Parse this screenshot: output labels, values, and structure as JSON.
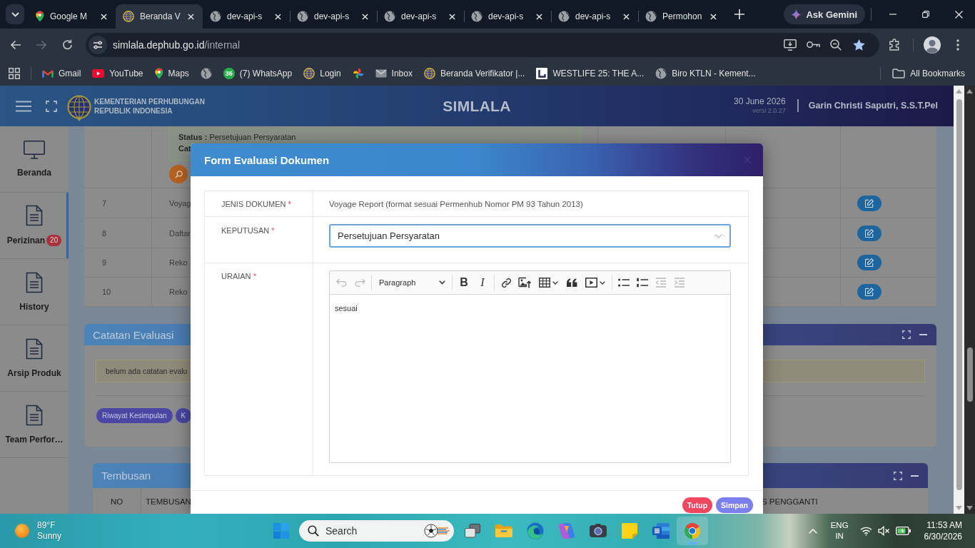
{
  "browser": {
    "tabs": [
      {
        "title": "Google M",
        "selected": false
      },
      {
        "title": "Beranda V",
        "selected": true
      },
      {
        "title": "dev-api-s",
        "selected": false
      },
      {
        "title": "dev-api-s",
        "selected": false
      },
      {
        "title": "dev-api-s",
        "selected": false
      },
      {
        "title": "dev-api-s",
        "selected": false
      },
      {
        "title": "dev-api-s",
        "selected": false
      },
      {
        "title": "Permohon",
        "selected": false
      }
    ],
    "gemini_button": "Ask Gemini",
    "forward_disabled": true,
    "address": {
      "host": "simlala.dephub.go.id",
      "path": "/internal"
    },
    "bookmarks": [
      {
        "kind": "link",
        "label": "Gmail"
      },
      {
        "kind": "link",
        "label": "YouTube"
      },
      {
        "kind": "link",
        "label": "Maps"
      },
      {
        "kind": "icon"
      },
      {
        "kind": "link",
        "label": "(7) WhatsApp",
        "badge": "36"
      },
      {
        "kind": "link",
        "label": "Login"
      },
      {
        "kind": "icon"
      },
      {
        "kind": "link",
        "label": "Inbox"
      },
      {
        "kind": "link",
        "label": "Beranda Verifikator |..."
      },
      {
        "kind": "link",
        "label": "WESTLIFE 25: THE A..."
      },
      {
        "kind": "link",
        "label": "Biro KTLN - Kement..."
      }
    ],
    "all_bookmarks": "All Bookmarks"
  },
  "header": {
    "org_line_1": "KEMENTERIAN PERHUBUNGAN",
    "org_line_2": "REPUBLIK INDONESIA",
    "title": "SIMLALA",
    "date": "30 June 2026",
    "version": "versi 2.0.27",
    "user": "Garin Christi Saputri, S.S.T.Pel"
  },
  "sidebar": {
    "items": [
      {
        "label": "Beranda",
        "selected": false
      },
      {
        "label": "Perizinan",
        "selected": true,
        "badge": "20"
      },
      {
        "label": "History",
        "selected": false
      },
      {
        "label": "Arsip Produk",
        "selected": false
      },
      {
        "label": "Team Perfor…",
        "selected": false
      }
    ]
  },
  "documents_table": {
    "note": {
      "status_line": "**Status :** Persetujuan Persyaratan",
      "cut_line": "Cat"
    },
    "rows": [
      {
        "no": "7",
        "document": "Voyag"
      },
      {
        "no": "8",
        "document": "Daftar"
      },
      {
        "no": "9",
        "document": "Reko"
      },
      {
        "no": "10",
        "document": "Reko"
      }
    ]
  },
  "evaluation_notes": {
    "title": "Catatan Evaluasi",
    "alert": "belum ada catatan evalu",
    "buttons": [
      "Riwayat Kesimpulan",
      "K"
    ]
  },
  "copies_panel": {
    "title": "Tembusan",
    "columns": [
      "NO",
      "TEMBUSAN",
      "S PENGGANTI"
    ]
  },
  "dialog": {
    "title": "Form Evaluasi Dokumen",
    "fields": [
      {
        "kind": "text",
        "label": "JENIS DOKUMEN",
        "required_mark": "*",
        "value": "Voyage Report (format sesuai Permenhub Nomor PM 93 Tahun 2013)"
      },
      {
        "kind": "select",
        "label": "KEPUTUSAN",
        "required_mark": "*",
        "value": "Persetujuan Persyaratan",
        "focused": true
      },
      {
        "kind": "editor",
        "label": "URAIAN",
        "required_mark": "*",
        "value": "sesuai",
        "toolbar": {
          "block_style": "Paragraph",
          "format_labels": [
            "B",
            "I"
          ],
          "undo_disabled": true,
          "redo_disabled": true,
          "outdent_disabled": true,
          "indent_disabled": true
        }
      }
    ],
    "buttons": [
      {
        "kind": "cancel",
        "label": "Tutup"
      },
      {
        "kind": "submit",
        "label": "Simpan"
      }
    ]
  },
  "taskbar": {
    "weather": {
      "temperature": "89°F",
      "condition": "Sunny"
    },
    "search_label": "Search",
    "apps": [
      {
        "active": false
      },
      {
        "active": false
      },
      {
        "active": false
      },
      {
        "active": false
      },
      {
        "active": false
      },
      {
        "active": false
      },
      {
        "active": false
      },
      {
        "active": true
      }
    ],
    "language": "ENG",
    "region": "IN",
    "time": "11:53 AM",
    "date": "6/30/2026"
  }
}
